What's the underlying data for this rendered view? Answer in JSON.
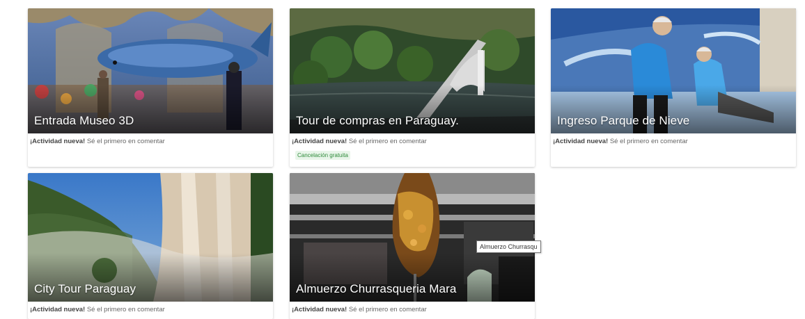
{
  "cards": [
    {
      "title": "Entrada Museo 3D",
      "meta_bold": "¡Actividad nueva!",
      "meta_rest": " Sé el primero en comentar"
    },
    {
      "title": "Tour de compras en Paraguay.",
      "meta_bold": "¡Actividad nueva!",
      "meta_rest": " Sé el primero en comentar",
      "badge": "Cancelación gratuita"
    },
    {
      "title": "Ingreso Parque de Nieve",
      "meta_bold": "¡Actividad nueva!",
      "meta_rest": " Sé el primero en comentar"
    },
    {
      "title": "City Tour Paraguay",
      "meta_bold": "¡Actividad nueva!",
      "meta_rest": " Sé el primero en comentar"
    },
    {
      "title": "Almuerzo Churrasqueria Mara",
      "meta_bold": "¡Actividad nueva!",
      "meta_rest": " Sé el primero en comentar"
    }
  ],
  "tooltip": "Almuerzo Churrasqu",
  "colors": {
    "badge_text": "#2e8b3a",
    "badge_bg": "#e8f5e9",
    "card_title": "#ffffff"
  }
}
